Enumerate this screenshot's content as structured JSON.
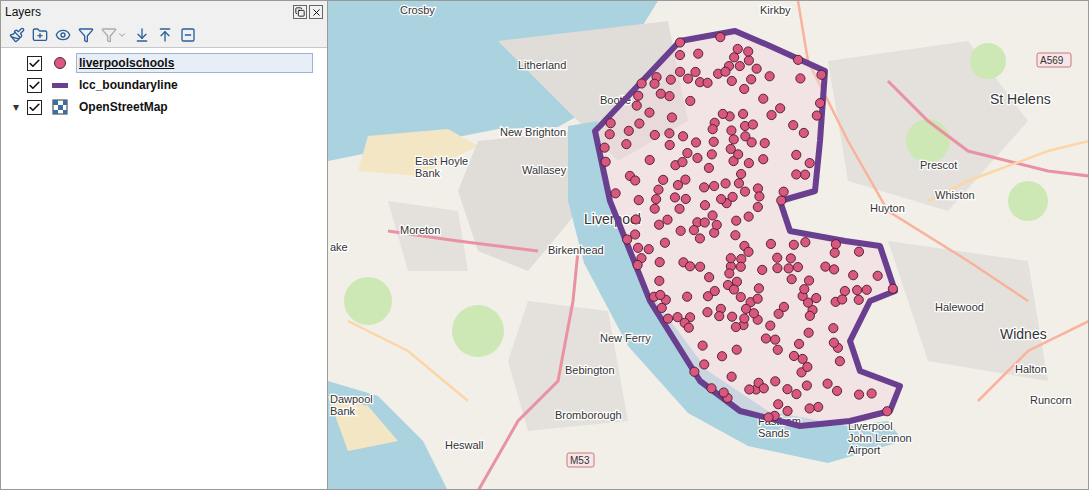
{
  "panel": {
    "title": "Layers"
  },
  "layers": [
    {
      "name": "liverpoolschools",
      "kind": "point",
      "checked": true,
      "selected": true,
      "color": "#d9587f"
    },
    {
      "name": "lcc_boundaryline",
      "kind": "line",
      "checked": true,
      "selected": false,
      "color": "#6b3f8f"
    },
    {
      "name": "OpenStreetMap",
      "kind": "raster",
      "checked": true,
      "selected": false,
      "color": "#3b6ea5",
      "toggle": "▾",
      "expanded": true
    }
  ],
  "map": {
    "labels": [
      {
        "lines": [
          "Crosby"
        ]
      },
      {
        "lines": [
          "Kirkby"
        ]
      },
      {
        "lines": [
          "Litherland"
        ]
      },
      {
        "lines": [
          "Bootle"
        ]
      },
      {
        "lines": [
          "New Brighton"
        ]
      },
      {
        "lines": [
          "Wallasey"
        ]
      },
      {
        "lines": [
          "East Hoyle",
          "Bank"
        ]
      },
      {
        "lines": [
          "Moreton"
        ]
      },
      {
        "lines": [
          "Liverpool"
        ]
      },
      {
        "lines": [
          "Birkenhead"
        ]
      },
      {
        "lines": [
          "St Helens"
        ]
      },
      {
        "lines": [
          "Prescot"
        ]
      },
      {
        "lines": [
          "Whiston"
        ]
      },
      {
        "lines": [
          "Huyton"
        ]
      },
      {
        "lines": [
          "Halewood"
        ]
      },
      {
        "lines": [
          "Widnes"
        ]
      },
      {
        "lines": [
          "New Ferry"
        ]
      },
      {
        "lines": [
          "Bebington"
        ]
      },
      {
        "lines": [
          "Bromborough"
        ]
      },
      {
        "lines": [
          "Heswall"
        ]
      },
      {
        "lines": [
          "Dawpool",
          "Bank"
        ]
      },
      {
        "lines": [
          "Fasthom",
          "Sands"
        ]
      },
      {
        "lines": [
          "Liverpool",
          "John Lennon",
          "Airport"
        ]
      },
      {
        "lines": [
          "Halton"
        ]
      },
      {
        "lines": [
          "Runcorn"
        ]
      },
      {
        "lines": [
          "ake"
        ]
      }
    ],
    "roads": [
      {
        "text": "M53"
      },
      {
        "text": "A569"
      }
    ]
  }
}
